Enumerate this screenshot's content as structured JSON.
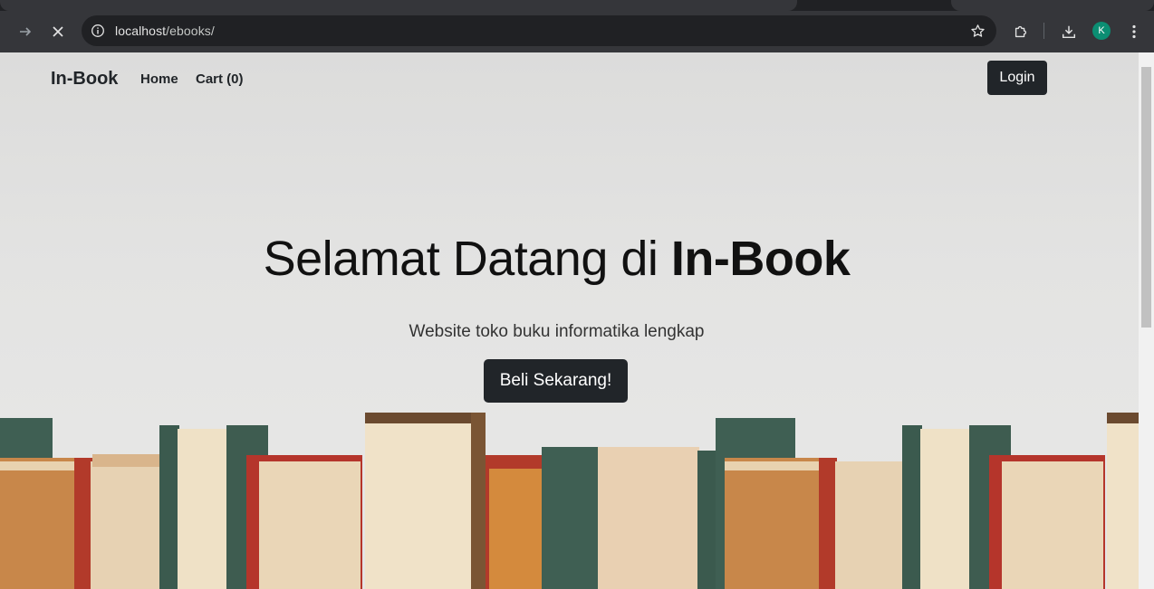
{
  "browser": {
    "url_host": "localhost",
    "url_path": "/ebooks/",
    "profile_initial": "K",
    "icons": {
      "forward": "arrow-right-icon",
      "stop": "close-icon",
      "site_info": "info-icon",
      "bookmark": "star-icon",
      "extensions": "puzzle-icon",
      "downloads": "download-icon",
      "menu": "more-vert-icon"
    }
  },
  "navbar": {
    "brand": "In-Book",
    "links": [
      "Home",
      "Cart (0)"
    ],
    "login_label": "Login"
  },
  "hero": {
    "title_prefix": "Selamat Datang di ",
    "title_strong": "In-Book",
    "subtitle": "Website toko buku informatika lengkap",
    "cta_label": "Beli Sekarang!"
  },
  "colors": {
    "dark_button": "#212529",
    "hero_background": "#e1e1e0",
    "avatar": "#0b8e73"
  }
}
